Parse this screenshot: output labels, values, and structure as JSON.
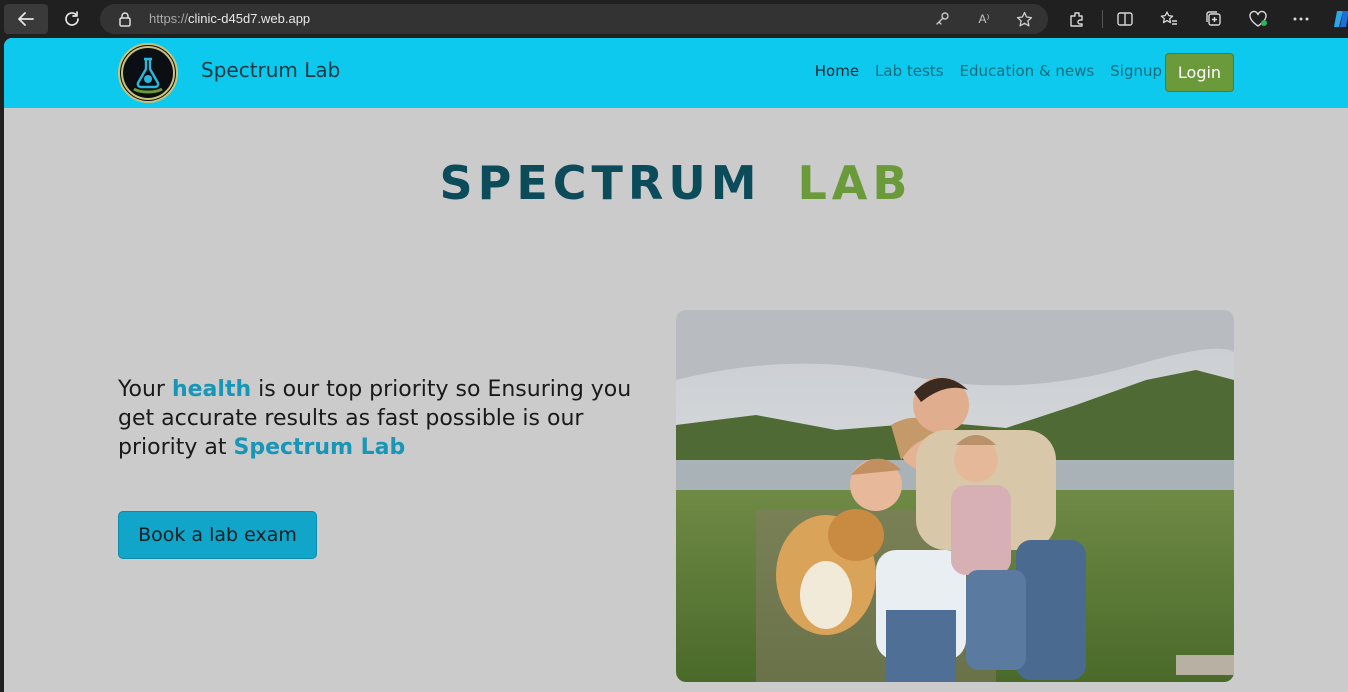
{
  "browser": {
    "url_scheme": "https://",
    "url_host": "clinic-d45d7.web.app",
    "read_aloud_label": "A⁾"
  },
  "header": {
    "brand": "Spectrum Lab",
    "nav": [
      "Home",
      "Lab tests",
      "Education & news",
      "Signup"
    ],
    "login_label": "Login"
  },
  "hero": {
    "title_word1": "SPECTRUM",
    "title_word2": "LAB",
    "tagline_part1": "Your ",
    "tagline_health": "health",
    "tagline_part2": " is our top priority so Ensuring you get accurate results as fast possible is our priority at ",
    "tagline_brand": "Spectrum Lab",
    "cta_label": "Book a lab exam"
  },
  "colors": {
    "nav_bg": "#0dc9ee",
    "page_bg": "#cbcbcb",
    "title_dark": "#0b4b5a",
    "accent_green": "#6a9a3a",
    "accent_blue": "#1796b8"
  }
}
